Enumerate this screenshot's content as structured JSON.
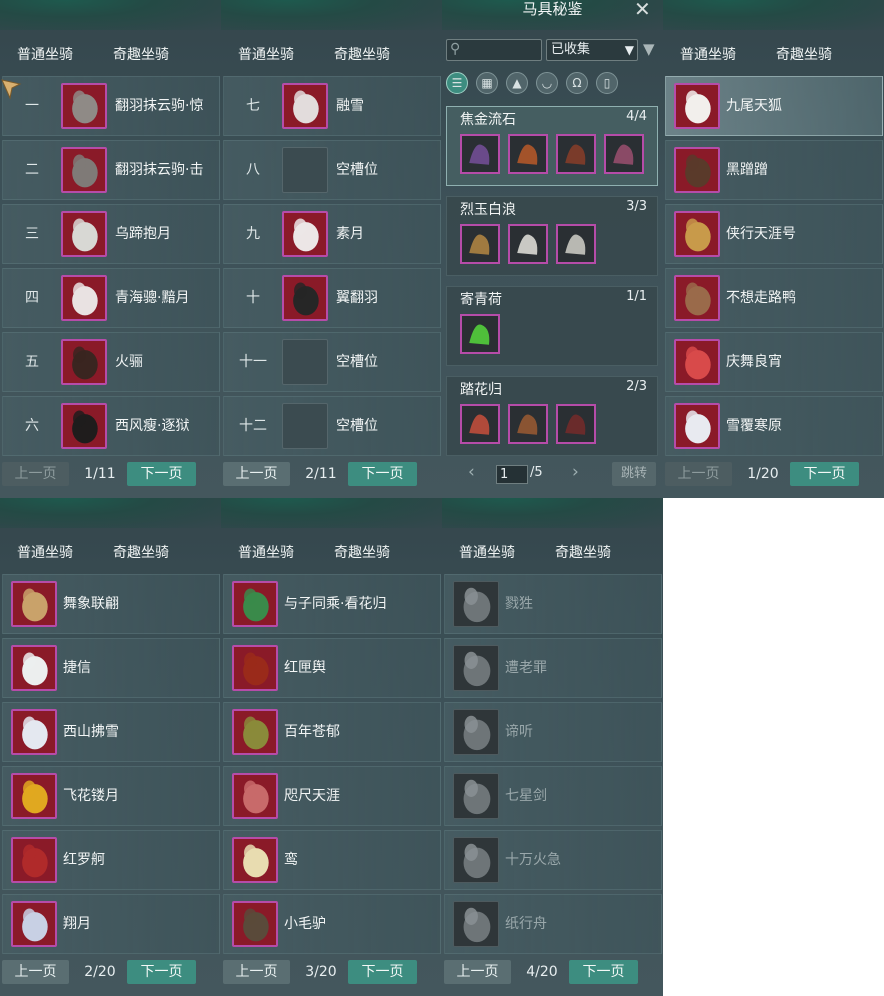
{
  "tabs": {
    "normal": "普通坐骑",
    "fun": "奇趣坐骑"
  },
  "buttons": {
    "prev": "上一页",
    "next": "下一页"
  },
  "panel1": {
    "page": "1/11",
    "rows": [
      {
        "num": "一",
        "name": "翻羽抹云驹·惊",
        "color": "#8f8a86"
      },
      {
        "num": "二",
        "name": "翻羽抹云驹·击",
        "color": "#7f7a77"
      },
      {
        "num": "三",
        "name": "乌蹄抱月",
        "color": "#d8d8d4"
      },
      {
        "num": "四",
        "name": "青海骢·黯月",
        "color": "#e9e2e2"
      },
      {
        "num": "五",
        "name": "火骊",
        "color": "#3a2520"
      },
      {
        "num": "六",
        "name": "西风瘦·逐狱",
        "color": "#1f1c1c"
      }
    ]
  },
  "panel2": {
    "page": "2/11",
    "rows": [
      {
        "num": "七",
        "name": "融雪",
        "color": "#e2dcdc",
        "empty": false
      },
      {
        "num": "八",
        "name": "空槽位",
        "empty": true
      },
      {
        "num": "九",
        "name": "素月",
        "color": "#ece6e6",
        "empty": false
      },
      {
        "num": "十",
        "name": "翼翻羽",
        "color": "#262626",
        "empty": false
      },
      {
        "num": "十一",
        "name": "空槽位",
        "empty": true
      },
      {
        "num": "十二",
        "name": "空槽位",
        "empty": true
      }
    ]
  },
  "panel3": {
    "title": "马具秘鉴",
    "filter_value": "已收集",
    "sets": [
      {
        "name": "焦金流石",
        "count": "4/4",
        "pieces": [
          "#6a4a8a",
          "#a3532a",
          "#7a3b2a",
          "#8a4a66"
        ]
      },
      {
        "name": "烈玉白浪",
        "count": "3/3",
        "pieces": [
          "#a07a40",
          "#c9c9c4",
          "#b8b8b2"
        ]
      },
      {
        "name": "寄青荷",
        "count": "1/1",
        "pieces": [
          "#4fbf3a"
        ]
      },
      {
        "name": "踏花归",
        "count": "2/3",
        "pieces": [
          "#b04a3a",
          "#8a5432",
          "#6a2b2b"
        ]
      }
    ],
    "page_input": "1",
    "page_total": "/5",
    "jump": "跳转"
  },
  "panel4": {
    "page": "1/20",
    "rows": [
      {
        "name": "九尾天狐",
        "color": "#f2efec"
      },
      {
        "name": "黑蹭蹭",
        "color": "#5a3a2a"
      },
      {
        "name": "侠行天涯号",
        "color": "#c89a4a"
      },
      {
        "name": "不想走路鸭",
        "color": "#9a6a4a"
      },
      {
        "name": "庆舞良宵",
        "color": "#d84a4a"
      },
      {
        "name": "雪覆寒原",
        "color": "#e8eaf0"
      }
    ]
  },
  "panel5": {
    "page": "2/20",
    "rows": [
      {
        "name": "舞象联翩",
        "color": "#c9a26a"
      },
      {
        "name": "捷信",
        "color": "#eceeee"
      },
      {
        "name": "西山拂雪",
        "color": "#e4e8f0"
      },
      {
        "name": "飞花镂月",
        "color": "#e0a820"
      },
      {
        "name": "红罗舸",
        "color": "#b02a2a"
      },
      {
        "name": "翔月",
        "color": "#c8d0e4"
      }
    ]
  },
  "panel6": {
    "page": "3/20",
    "rows": [
      {
        "name": "与子同乘·看花归",
        "color": "#3a8a4a"
      },
      {
        "name": "红匣舆",
        "color": "#9a2a1a"
      },
      {
        "name": "百年苍郁",
        "color": "#8a8a3a"
      },
      {
        "name": "咫尺天涯",
        "color": "#c86a6a"
      },
      {
        "name": "鸾",
        "color": "#e8dcb0"
      },
      {
        "name": "小毛驴",
        "color": "#5a4a3a"
      }
    ]
  },
  "panel7": {
    "page": "4/20",
    "rows": [
      {
        "name": "戮狌"
      },
      {
        "name": "遭老罪"
      },
      {
        "name": "谛听"
      },
      {
        "name": "七星剑"
      },
      {
        "name": "十万火急"
      },
      {
        "name": "纸行舟"
      }
    ]
  }
}
